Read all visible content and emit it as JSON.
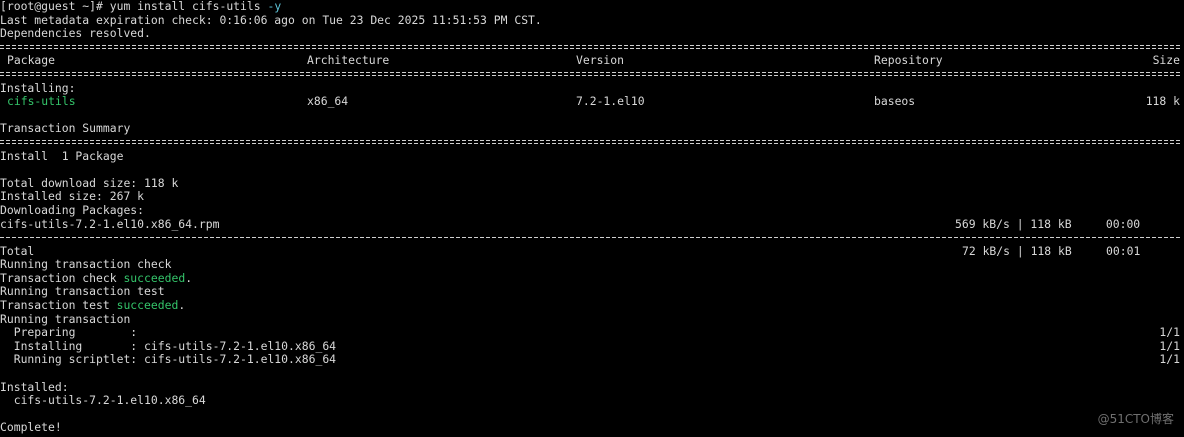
{
  "prompt_line": {
    "prompt": "[root@guest ~]#",
    "command": " yum install cifs-utils ",
    "flag": "-y"
  },
  "metadata_line": "Last metadata expiration check: 0:16:06 ago on Tue 23 Dec 2025 11:51:53 PM CST.",
  "deps_line": "Dependencies resolved.",
  "table": {
    "headers": {
      "package": "Package",
      "architecture": "Architecture",
      "version": "Version",
      "repository": "Repository",
      "size": "Size"
    },
    "section_label": "Installing:",
    "row": {
      "package": "cifs-utils",
      "architecture": "x86_64",
      "version": "7.2-1.el10",
      "repository": "baseos",
      "size": "118 k"
    }
  },
  "summary": {
    "title": "Transaction Summary",
    "install_line": "Install  1 Package",
    "download_size": "Total download size: 118 k",
    "installed_size": "Installed size: 267 k",
    "downloading": "Downloading Packages:"
  },
  "download": {
    "file": "cifs-utils-7.2-1.el10.x86_64.rpm",
    "stats": "569 kB/s | 118 kB     00:00",
    "total_label": "Total",
    "total_stats": "72 kB/s | 118 kB     00:01"
  },
  "transaction": {
    "running_check": "Running transaction check",
    "check_prefix": "Transaction check ",
    "check_status": "succeeded",
    "check_suffix": ".",
    "running_test": "Running transaction test",
    "test_prefix": "Transaction test ",
    "test_status": "succeeded",
    "test_suffix": ".",
    "running": "Running transaction",
    "steps": [
      {
        "label": "  Preparing        :",
        "count": "1/1"
      },
      {
        "label": "  Installing       : cifs-utils-7.2-1.el10.x86_64",
        "count": "1/1"
      },
      {
        "label": "  Running scriptlet: cifs-utils-7.2-1.el10.x86_64",
        "count": "1/1"
      }
    ]
  },
  "result": {
    "installed_label": "Installed:",
    "installed_pkg": "  cifs-utils-7.2-1.el10.x86_64",
    "complete": "Complete!"
  },
  "watermark": "@51CTO博客",
  "colors": {
    "background": "#000000",
    "text": "#d8d8d8",
    "success_green": "#34c46a",
    "flag_cyan": "#5fc4d8"
  }
}
